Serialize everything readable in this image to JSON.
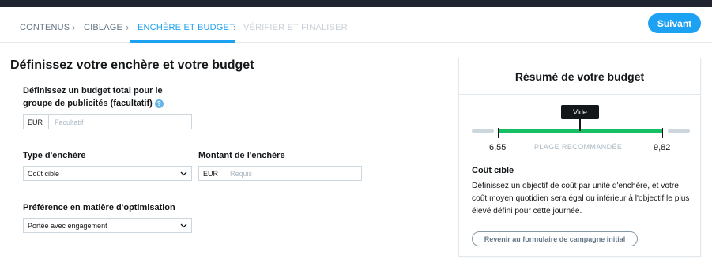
{
  "steps": [
    {
      "label": "CONTENUS",
      "state": "done"
    },
    {
      "label": "CIBLAGE",
      "state": "done"
    },
    {
      "label": "ENCHÈRE ET BUDGET",
      "state": "active"
    },
    {
      "label": "VÉRIFIER ET FINALISER",
      "state": "disabled"
    }
  ],
  "actions": {
    "next_label": "Suivant"
  },
  "page": {
    "title": "Définissez votre enchère et votre budget"
  },
  "budget": {
    "label_line1": "Définissez un budget total pour le",
    "label_line2": "groupe de publicités (facultatif)",
    "help_icon": "?",
    "currency": "EUR",
    "placeholder": "Facultatif",
    "value": ""
  },
  "bid_type": {
    "label": "Type d'enchère",
    "selected": "Coût cible"
  },
  "bid_amount": {
    "label": "Montant de l'enchère",
    "currency": "EUR",
    "placeholder": "Requis",
    "value": ""
  },
  "optimization": {
    "label": "Préférence en matière d'optimisation",
    "selected": "Portée avec engagement"
  },
  "summary": {
    "title": "Résumé de votre budget",
    "tooltip": "Vide",
    "range_min": "6,55",
    "range_max": "9,82",
    "range_label": "PLAGE RECOMMANDÉE",
    "desc_title": "Coût cible",
    "desc_text": "Définissez un objectif de coût par unité d'enchère, et votre coût moyen quotidien sera égal ou inférieur à l'objectif le plus élevé défini pour cette journée.",
    "back_label": "Revenir au formulaire de campagne initial"
  },
  "colors": {
    "accent": "#1da1f2",
    "range_green": "#17bf63",
    "dark": "#14171a",
    "muted": "#657786"
  },
  "icons": {
    "chevron": "chevron-right-icon",
    "caret": "chevron-down-icon",
    "help": "help-icon"
  }
}
